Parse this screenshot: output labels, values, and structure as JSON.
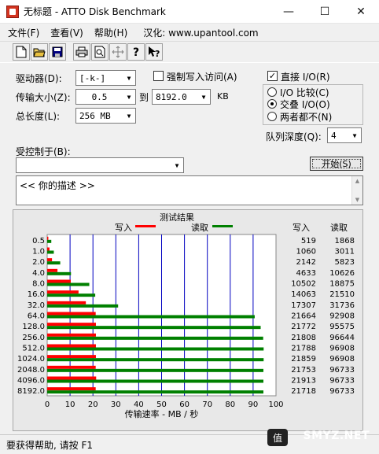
{
  "window": {
    "title": "无标题 - ATTO Disk Benchmark",
    "minimize": "—",
    "maximize": "☐",
    "close": "✕"
  },
  "menu": {
    "file": "文件(F)",
    "view": "查看(V)",
    "help": "帮助(H)",
    "url": "汉化: www.upantool.com"
  },
  "toolbar": {
    "icons": [
      "new-icon",
      "open-icon",
      "save-icon",
      "print-icon",
      "print-preview-icon",
      "move-icon",
      "help-icon",
      "context-help-icon"
    ]
  },
  "controls": {
    "drive_label": "驱动器(D):",
    "drive_value": "[-k-]",
    "force_write_label": "强制写入访问(A)",
    "force_write_checked": false,
    "transfer_size_label": "传输大小(Z):",
    "transfer_from": "0.5",
    "to_label": "到",
    "transfer_to": "8192.0",
    "kb_label": "KB",
    "total_length_label": "总长度(L):",
    "total_length_value": "256 MB",
    "direct_io_label": "直接 I/O(R)",
    "direct_io_checked": true,
    "io_compare_label": "I/O 比较(C)",
    "overlap_io_label": "交叠 I/O(O)",
    "neither_label": "两者都不(N)",
    "selected_io_mode": "overlap",
    "queue_depth_label": "队列深度(Q):",
    "queue_depth_value": "4",
    "controlled_by_label": "受控制于(B):",
    "controlled_by_value": "",
    "start_button": "开始(S)",
    "description_text": "<<   你的描述   >>"
  },
  "results": {
    "title": "测试结果",
    "legend_write": "写入",
    "legend_read": "读取",
    "col_write": "写入",
    "col_read": "读取"
  },
  "chart_data": {
    "type": "bar",
    "title": "测试结果",
    "xlabel": "传输速率 - MB / 秒",
    "xlim": [
      0,
      100
    ],
    "x_ticks": [
      "0",
      "10",
      "20",
      "30",
      "40",
      "50",
      "60",
      "70",
      "80",
      "90",
      "100"
    ],
    "categories": [
      "0.5",
      "1.0",
      "2.0",
      "4.0",
      "8.0",
      "16.0",
      "32.0",
      "64.0",
      "128.0",
      "256.0",
      "512.0",
      "1024.0",
      "2048.0",
      "4096.0",
      "8192.0"
    ],
    "series": [
      {
        "name": "写入",
        "color": "#ff0000",
        "values": [
          0.5,
          1.0,
          2.1,
          4.5,
          10.3,
          13.7,
          16.9,
          21.2,
          21.3,
          21.3,
          21.3,
          21.3,
          21.2,
          21.4,
          21.2
        ],
        "labels": [
          "519",
          "1060",
          "2142",
          "4633",
          "10502",
          "14063",
          "17307",
          "21664",
          "21772",
          "21808",
          "21788",
          "21859",
          "21753",
          "21913",
          "21718"
        ]
      },
      {
        "name": "读取",
        "color": "#008000",
        "values": [
          1.8,
          2.9,
          5.7,
          10.4,
          18.4,
          21.0,
          31.0,
          90.7,
          93.3,
          94.4,
          94.6,
          94.6,
          94.5,
          94.5,
          94.5
        ],
        "labels": [
          "1868",
          "3011",
          "5823",
          "10626",
          "18875",
          "21510",
          "31736",
          "92908",
          "95575",
          "96644",
          "96908",
          "96908",
          "96733",
          "96733",
          "96733"
        ]
      }
    ]
  },
  "status": {
    "text": "要获得帮助, 请按 F1"
  },
  "watermark": {
    "badge": "值",
    "text": "SMYZ.NET"
  }
}
